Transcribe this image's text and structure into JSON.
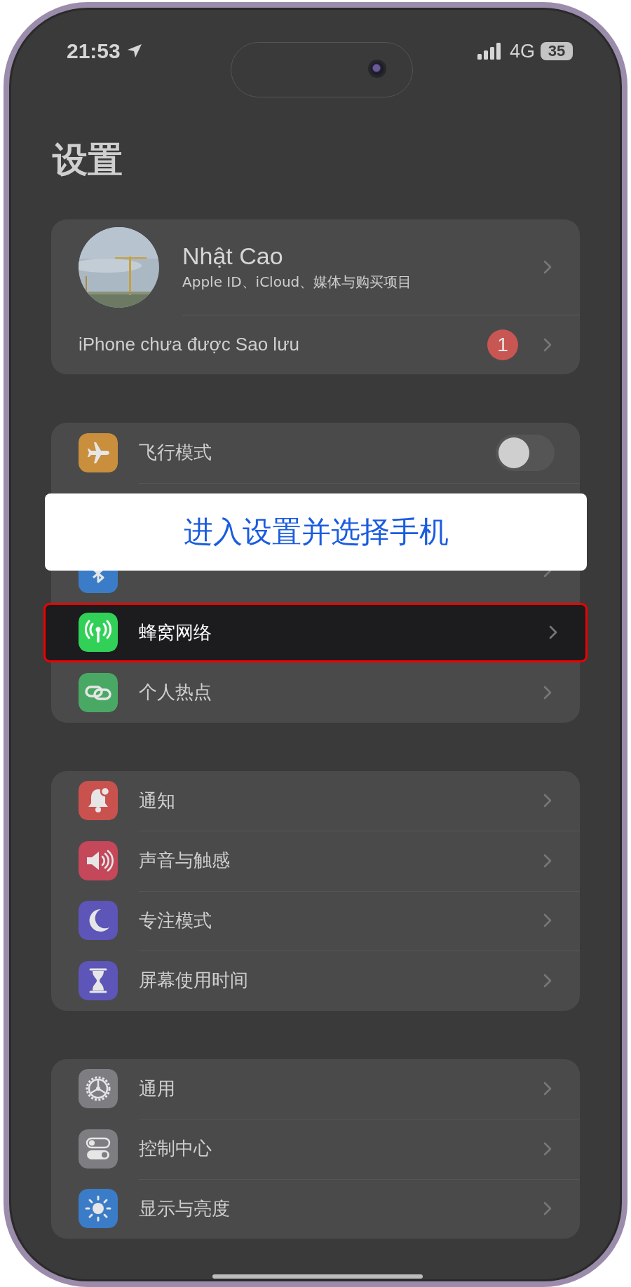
{
  "status_bar": {
    "time": "21:53",
    "network": "4G",
    "battery": "35"
  },
  "title": "设置",
  "profile": {
    "name": "Nhật Cao",
    "subtitle": "Apple ID、iCloud、媒体与购买项目",
    "backup": "iPhone chưa được Sao lưu",
    "badge": "1"
  },
  "groups": [
    {
      "rows": [
        {
          "kind": "toggle",
          "label": "飞行模式",
          "color": "#c98f3c",
          "on": false,
          "highlighted": false
        },
        {
          "kind": "hidden"
        },
        {
          "kind": "partial",
          "color": "#3a7cc8"
        },
        {
          "kind": "link",
          "label": "蜂窝网络",
          "color": "#31d158",
          "highlighted": true
        },
        {
          "kind": "link",
          "label": "个人热点",
          "color": "#4aa865",
          "highlighted": false
        }
      ]
    },
    {
      "rows": [
        {
          "kind": "link",
          "label": "通知",
          "color": "#c9524e",
          "highlighted": false
        },
        {
          "kind": "link",
          "label": "声音与触感",
          "color": "#c4475a",
          "highlighted": false
        },
        {
          "kind": "link",
          "label": "专注模式",
          "color": "#5d55b8",
          "highlighted": false
        },
        {
          "kind": "link",
          "label": "屏幕使用时间",
          "color": "#5d55b8",
          "highlighted": false
        }
      ]
    },
    {
      "rows": [
        {
          "kind": "link",
          "label": "通用",
          "color": "#7d7d82",
          "highlighted": false
        },
        {
          "kind": "link",
          "label": "控制中心",
          "color": "#7d7d82",
          "highlighted": false
        },
        {
          "kind": "link",
          "label": "显示与亮度",
          "color": "#3a7cc8",
          "highlighted": false
        }
      ]
    }
  ],
  "callout": {
    "text": "进入设置并选择手机"
  }
}
